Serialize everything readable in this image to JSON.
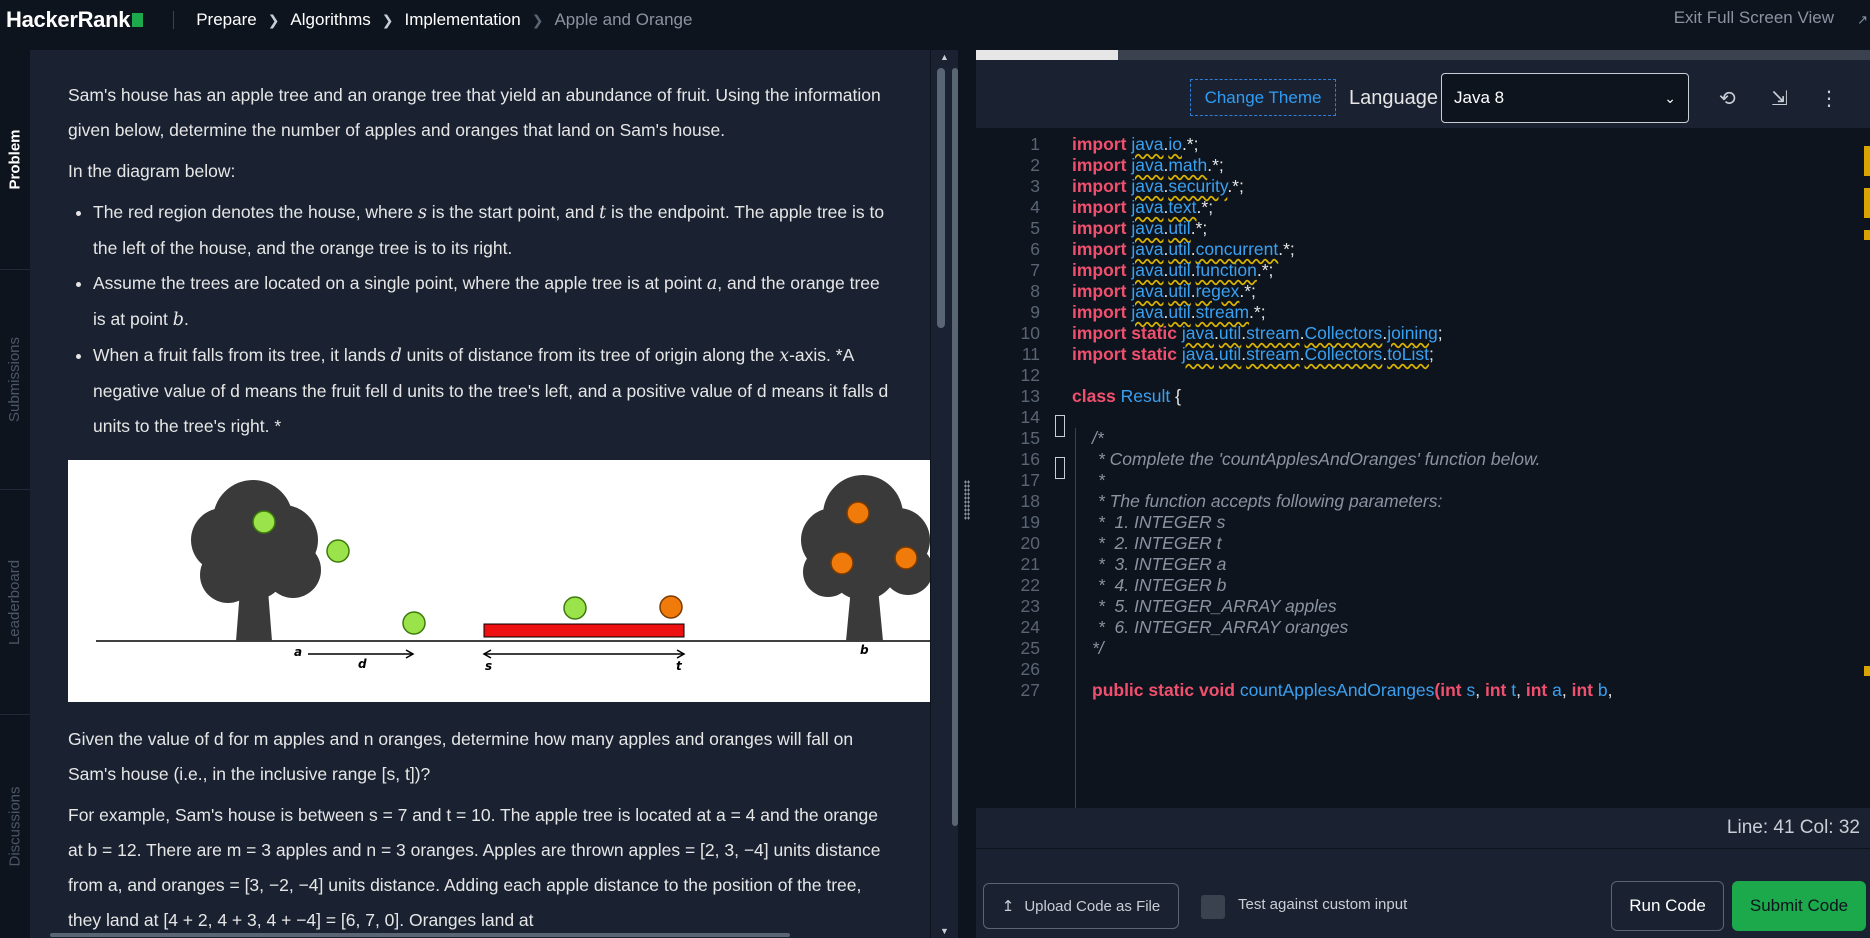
{
  "header": {
    "logo": "HackerRank",
    "breadcrumbs": [
      {
        "label": "Prepare"
      },
      {
        "label": "Algorithms"
      },
      {
        "label": "Implementation"
      },
      {
        "label": "Apple and Orange"
      }
    ],
    "exit_fullscreen": "Exit Full Screen View"
  },
  "vertical_tabs": [
    {
      "label": "Problem",
      "active": true
    },
    {
      "label": "Submissions",
      "active": false
    },
    {
      "label": "Leaderboard",
      "active": false
    },
    {
      "label": "Discussions",
      "active": false
    }
  ],
  "problem": {
    "intro": "Sam's house has an apple tree and an orange tree that yield an abundance of fruit. Using the information given below, determine the number of apples and oranges that land on Sam's house.",
    "diagram_heading": "In the diagram below:",
    "bullets": [
      {
        "pre": "The red region denotes the house, where ",
        "v1": "s",
        "mid": " is the start point, and ",
        "v2": "t",
        "post": " is the endpoint. The apple tree is to the left of the house, and the orange tree is to its right."
      },
      {
        "pre": "Assume the trees are located on a single point, where the apple tree is at point ",
        "v1": "a",
        "mid": ", and the orange tree is at point ",
        "v2": "b",
        "post": "."
      },
      {
        "pre": "When a fruit falls from its tree, it lands ",
        "v1": "d",
        "mid": " units of distance from its tree of origin along the ",
        "v2": "x",
        "post": "-axis. *A negative value of d means the fruit fell d units to the tree's left, and a positive value of d means it falls d units to the tree's right. *"
      }
    ],
    "diagram_labels": {
      "a": "a",
      "d": "d",
      "s": "s",
      "t": "t",
      "b": "b"
    },
    "given": "Given the value of d for m apples and n oranges, determine how many apples and oranges will fall on Sam's house (i.e., in the inclusive range [s, t])?",
    "example": "For example, Sam's house is between s = 7 and t = 10. The apple tree is located at a = 4 and the orange at b = 12. There are m = 3 apples and n = 3 oranges. Apples are thrown apples = [2, 3, −4] units distance from a, and oranges = [3, −2, −4] units distance. Adding each apple distance to the position of the tree, they land at [4 + 2, 4 + 3, 4 + −4] = [6, 7, 0]. Oranges land at"
  },
  "editor": {
    "change_theme": "Change Theme",
    "language_label": "Language",
    "language_value": "Java 8",
    "icons": [
      "history-icon",
      "collapse-icon",
      "more-icon"
    ],
    "lines": [
      {
        "n": "1",
        "kw": "import",
        "rest": "java.io.*;"
      },
      {
        "n": "2",
        "kw": "import",
        "rest": "java.math.*;"
      },
      {
        "n": "3",
        "kw": "import",
        "rest": "java.security.*;"
      },
      {
        "n": "4",
        "kw": "import",
        "rest": "java.text.*;"
      },
      {
        "n": "5",
        "kw": "import",
        "rest": "java.util.*;"
      },
      {
        "n": "6",
        "kw": "import",
        "rest": "java.util.concurrent.*;"
      },
      {
        "n": "7",
        "kw": "import",
        "rest": "java.util.function.*;"
      },
      {
        "n": "8",
        "kw": "import",
        "rest": "java.util.regex.*;"
      },
      {
        "n": "9",
        "kw": "import",
        "rest": "java.util.stream.*;"
      },
      {
        "n": "10",
        "kw": "import static",
        "rest": "java.util.stream.Collectors.joining;"
      },
      {
        "n": "11",
        "kw": "import static",
        "rest": "java.util.stream.Collectors.toList;"
      },
      {
        "n": "12",
        "kw": "",
        "rest": ""
      },
      {
        "n": "13",
        "kw": "class",
        "rest": "Result {"
      },
      {
        "n": "14",
        "kw": "",
        "rest": ""
      },
      {
        "n": "15",
        "kw": "",
        "rest": "/*"
      },
      {
        "n": "16",
        "kw": "",
        "rest": "* Complete the 'countApplesAndOranges' function below."
      },
      {
        "n": "17",
        "kw": "",
        "rest": "*"
      },
      {
        "n": "18",
        "kw": "",
        "rest": "* The function accepts following parameters:"
      },
      {
        "n": "19",
        "kw": "",
        "rest": "*  1. INTEGER s"
      },
      {
        "n": "20",
        "kw": "",
        "rest": "*  2. INTEGER t"
      },
      {
        "n": "21",
        "kw": "",
        "rest": "*  3. INTEGER a"
      },
      {
        "n": "22",
        "kw": "",
        "rest": "*  4. INTEGER b"
      },
      {
        "n": "23",
        "kw": "",
        "rest": "*  5. INTEGER_ARRAY apples"
      },
      {
        "n": "24",
        "kw": "",
        "rest": "*  6. INTEGER_ARRAY oranges"
      },
      {
        "n": "25",
        "kw": "",
        "rest": "*/"
      },
      {
        "n": "26",
        "kw": "",
        "rest": ""
      },
      {
        "n": "27",
        "kw": "public static void",
        "rest": "countApplesAndOranges(int s, int t, int a, int b,"
      }
    ],
    "status": "Line: 41 Col: 32"
  },
  "actions": {
    "upload": "Upload Code as File",
    "custom_input": "Test against custom input",
    "run": "Run Code",
    "submit": "Submit Code"
  },
  "colors": {
    "accent_green": "#1ba94c",
    "keyword": "#f0506e",
    "identifier": "#3aa0f0",
    "link_blue": "#2f9cf4",
    "panel_bg": "#1a2231",
    "page_bg": "#0e141e"
  }
}
